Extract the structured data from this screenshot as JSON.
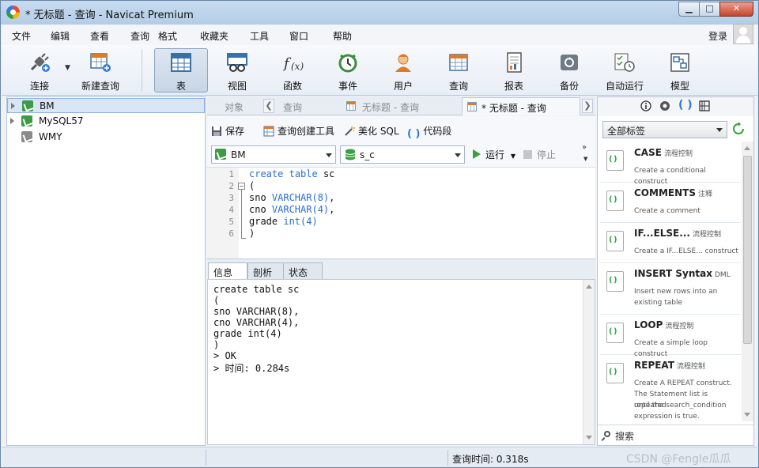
{
  "window": {
    "title": "* 无标题 - 查询 - Navicat Premium"
  },
  "menu": [
    "文件",
    "编辑",
    "查看",
    "查询",
    "格式",
    "收藏夹",
    "工具",
    "窗口",
    "帮助"
  ],
  "login_label": "登录",
  "toolbar": {
    "items": [
      {
        "label": "连接",
        "icon": "plug-icon"
      },
      {
        "label": "新建查询",
        "icon": "new-query-icon"
      },
      {
        "label": "表",
        "icon": "table-icon",
        "active": true
      },
      {
        "label": "视图",
        "icon": "view-icon"
      },
      {
        "label": "函数",
        "icon": "function-icon"
      },
      {
        "label": "事件",
        "icon": "clock-icon"
      },
      {
        "label": "用户",
        "icon": "user-icon"
      },
      {
        "label": "查询",
        "icon": "query-icon"
      },
      {
        "label": "报表",
        "icon": "report-icon"
      },
      {
        "label": "备份",
        "icon": "backup-icon"
      },
      {
        "label": "自动运行",
        "icon": "schedule-icon"
      },
      {
        "label": "模型",
        "icon": "model-icon"
      }
    ]
  },
  "connections": [
    {
      "name": "BM",
      "selected": true
    },
    {
      "name": "MySQL57"
    },
    {
      "name": "WMY"
    }
  ],
  "tabs": [
    {
      "label": "对象"
    },
    {
      "label": "查询"
    },
    {
      "label": "无标题 - 查询"
    },
    {
      "label": "* 无标题 - 查询",
      "active": true
    }
  ],
  "editor_toolbar": {
    "save": "保存",
    "query_builder": "查询创建工具",
    "beautify": "美化 SQL",
    "snippet": "代码段",
    "connection": "BM",
    "database": "s_c",
    "run": "运行",
    "stop": "停止"
  },
  "code": {
    "line_numbers": [
      "1",
      "2",
      "3",
      "4",
      "5",
      "6"
    ],
    "lines": [
      {
        "kw1": "create",
        "mid1": " ",
        "kw2": "table",
        "rest": " sc"
      },
      {
        "text": "("
      },
      {
        "pre": "sno ",
        "kw": "VARCHAR",
        "num": "(8)",
        "post": ","
      },
      {
        "pre": "cno ",
        "kw": "VARCHAR",
        "num": "(4)",
        "post": ","
      },
      {
        "pre": "grade ",
        "kw": "int",
        "num": "(4)",
        "post": ""
      },
      {
        "text": ")"
      }
    ]
  },
  "result_tabs": [
    "信息",
    "剖析",
    "状态"
  ],
  "output_lines": [
    "create table sc",
    "(",
    "sno VARCHAR(8),",
    "cno VARCHAR(4),",
    "grade int(4)",
    ")",
    "> OK",
    "> 时间: 0.284s"
  ],
  "snippets_panel": {
    "filter": "全部标签",
    "search": "搜索",
    "items": [
      {
        "title": "CASE",
        "category": "流程控制",
        "desc": [
          "Create a conditional construct"
        ]
      },
      {
        "title": "COMMENTS",
        "category": "注释",
        "desc": [
          "Create a comment"
        ]
      },
      {
        "title": "IF...ELSE...",
        "category": "流程控制",
        "desc": [
          "Create a IF...ELSE... construct"
        ]
      },
      {
        "title": "INSERT Syntax",
        "category": "DML",
        "desc": [
          "Insert new rows into an",
          "existing table"
        ]
      },
      {
        "title": "LOOP",
        "category": "流程控制",
        "desc": [
          "Create a simple loop construct"
        ]
      },
      {
        "title": "REPEAT",
        "category": "流程控制",
        "desc": [
          "Create A REPEAT construct.",
          "The Statement list is repeated",
          "until the search_condition",
          "expression is true."
        ]
      }
    ]
  },
  "status": {
    "query_time": "查询时间: 0.318s",
    "watermark": "CSDN @Fengle瓜瓜"
  },
  "colors": {
    "keyword": "#2a6ed1",
    "run_green": "#3aa13f",
    "selection": "#d8e6f6"
  }
}
